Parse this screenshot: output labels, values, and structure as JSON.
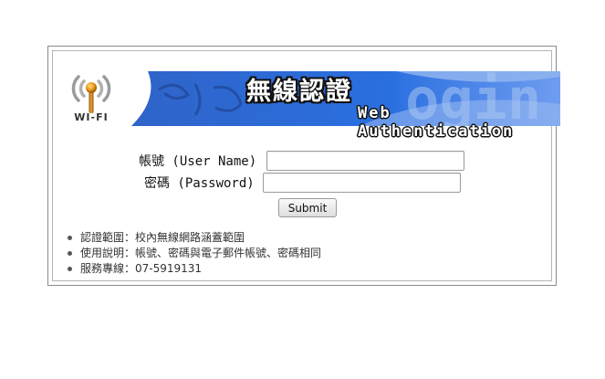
{
  "banner": {
    "logo_text": "WI-FI",
    "title_cn": "無線認證",
    "title_en": "Web Authentication",
    "background_word": "ogin",
    "colors": {
      "banner_blue": "#2b6fd6",
      "banner_light": "#8fb4ee"
    }
  },
  "form": {
    "username_label": "帳號 (User Name)",
    "username_value": "",
    "password_label": "密碼 (Password)",
    "password_value": "",
    "submit_label": "Submit"
  },
  "info": {
    "items": [
      "認證範圍：校內無線網路涵蓋範圍",
      "使用說明：帳號、密碼與電子郵件帳號、密碼相同",
      "服務專線：07-5919131"
    ]
  }
}
